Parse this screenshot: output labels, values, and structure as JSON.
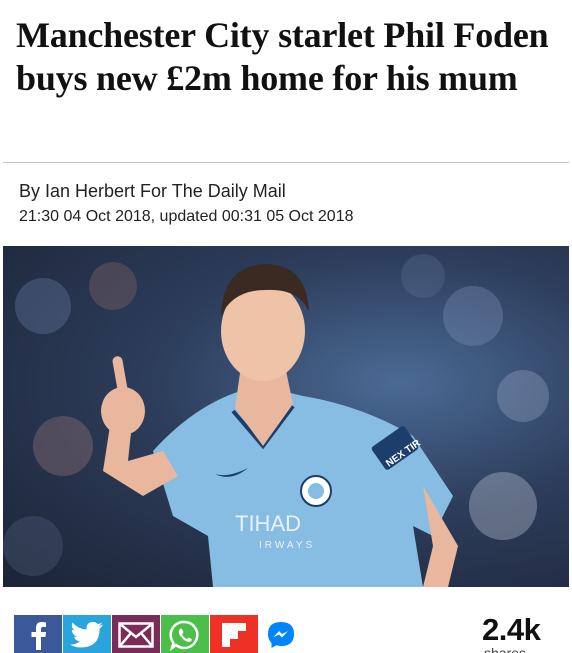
{
  "article": {
    "headline": "Manchester City starlet Phil Foden buys new £2m home for his mum",
    "byline": "By Ian Herbert For The Daily Mail",
    "dateline": "21:30 04 Oct 2018, updated 00:31 05 Oct 2018"
  },
  "photo": {
    "shirt_sponsor_line1": "TIHAD",
    "shirt_sponsor_line2": "IRWAYS",
    "sleeve_badge": "NEX TIR"
  },
  "share": {
    "buttons": [
      {
        "icon": "facebook-icon",
        "color": "#3b5998"
      },
      {
        "icon": "twitter-icon",
        "color": "#2aa4dc"
      },
      {
        "icon": "email-icon",
        "color": "#7b2b57"
      },
      {
        "icon": "whatsapp-icon",
        "color": "#4cbf4b"
      },
      {
        "icon": "flipboard-icon",
        "color": "#ee3124"
      },
      {
        "icon": "messenger-icon",
        "color": "#0084ff"
      }
    ],
    "count": "2.4k",
    "count_label": "shares"
  }
}
